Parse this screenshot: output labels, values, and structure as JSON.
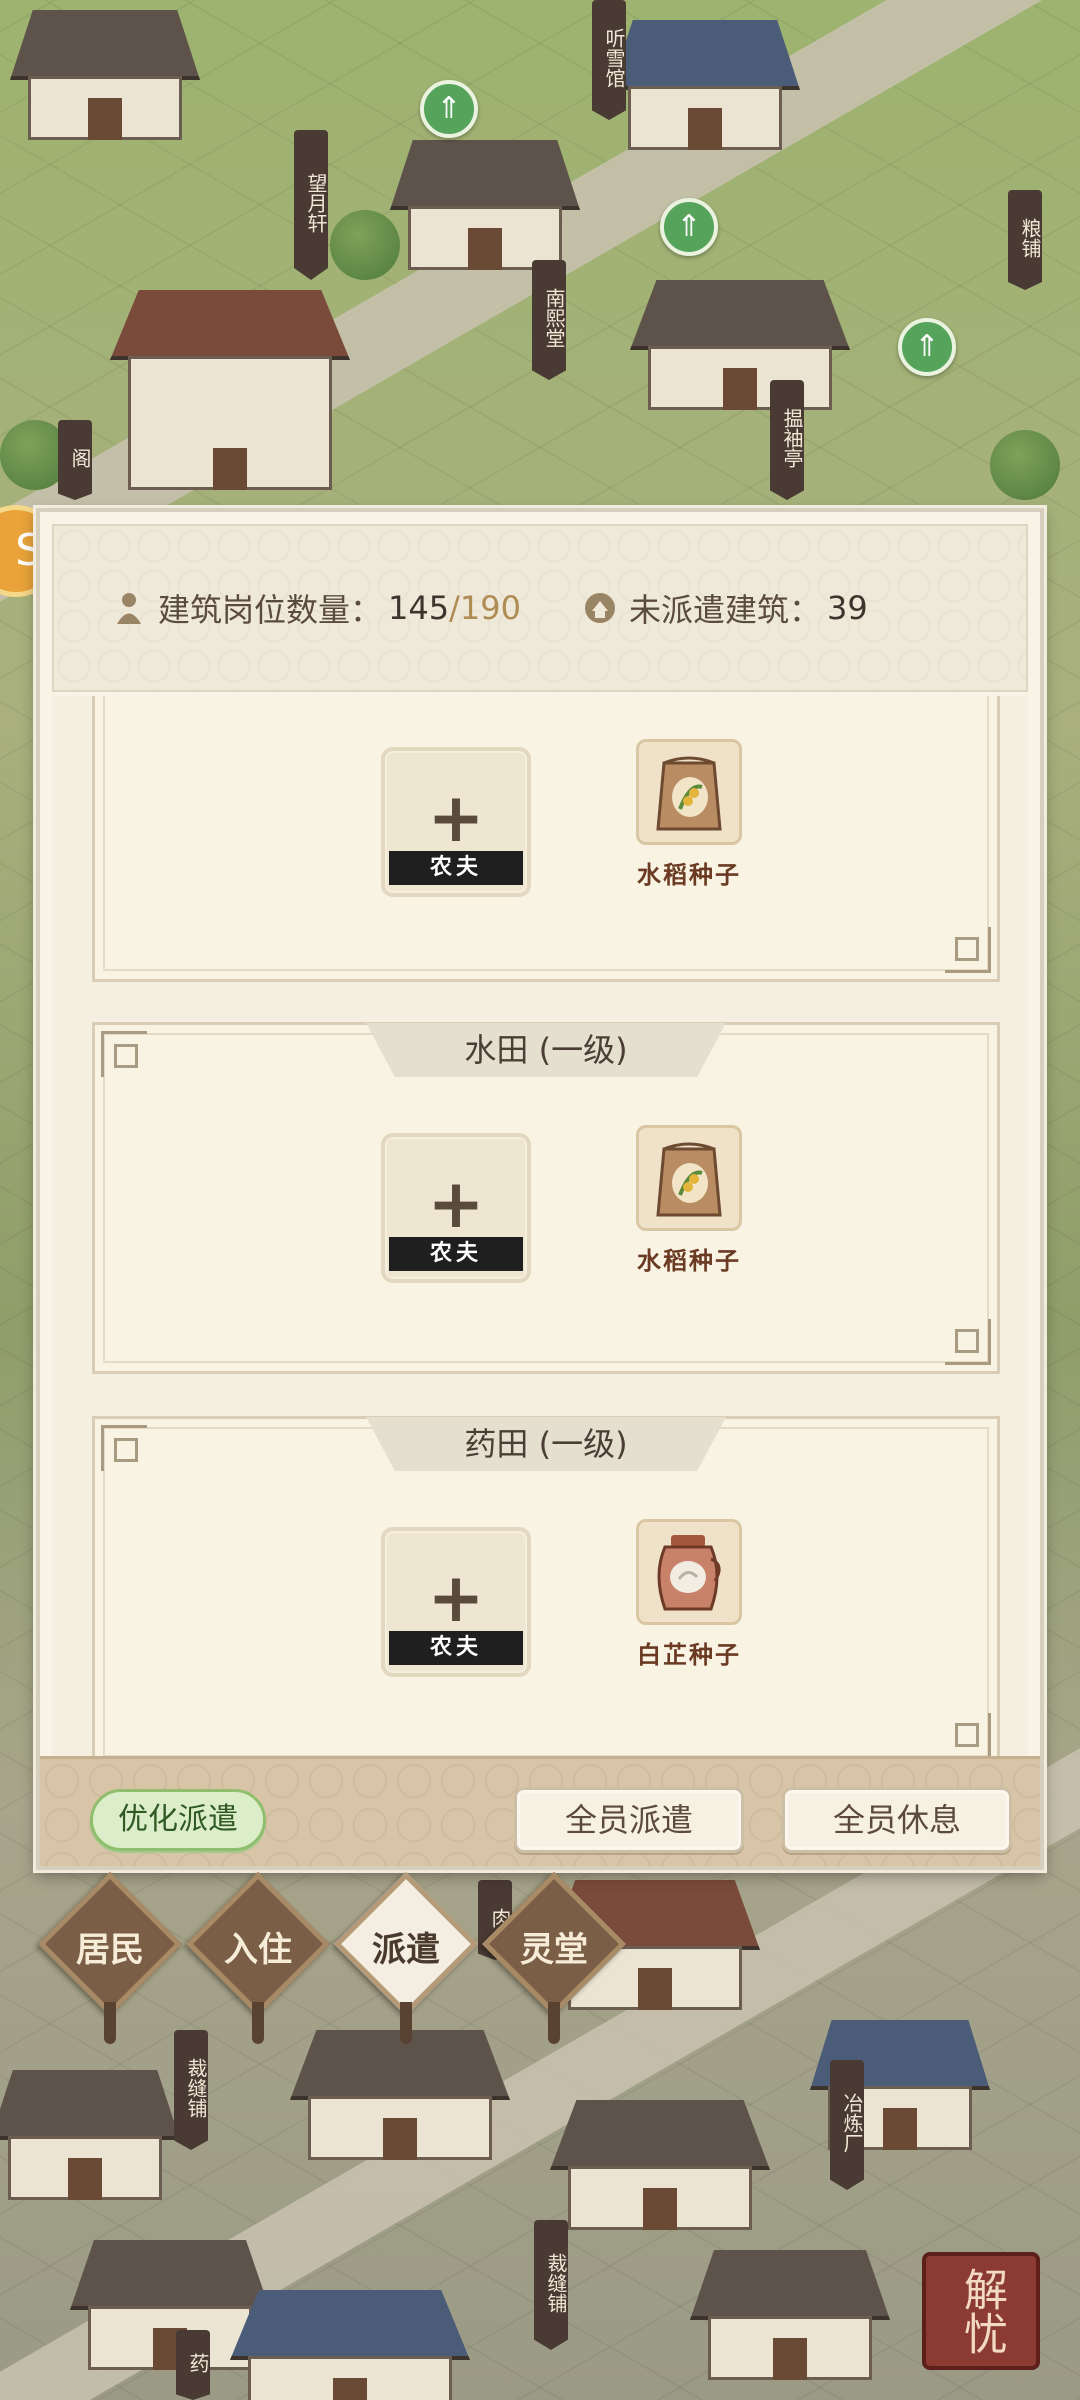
{
  "map": {
    "building_signs": [
      "听雪馆",
      "望月轩",
      "南熙堂",
      "粮铺",
      "揾袖亭",
      "阁",
      "裁缝铺",
      "冶炼厂",
      "裁缝铺",
      "药",
      "肉"
    ],
    "logo_text": "解忧"
  },
  "panel": {
    "stats": {
      "positions_label": "建筑岗位数量：",
      "positions_current": "145",
      "positions_max": "/190",
      "unassigned_label": "未派遣建筑：",
      "unassigned_value": "39"
    },
    "cards": [
      {
        "title": "",
        "role": "农夫",
        "reward_label": "水稻种子",
        "reward_icon": "rice-seed-bag-icon"
      },
      {
        "title": "水田 (一级)",
        "role": "农夫",
        "reward_label": "水稻种子",
        "reward_icon": "rice-seed-bag-icon"
      },
      {
        "title": "药田 (一级)",
        "role": "农夫",
        "reward_label": "白芷种子",
        "reward_icon": "angelica-seed-jar-icon"
      }
    ],
    "footer": {
      "optimize": "优化派遣",
      "all_dispatch": "全员派遣",
      "all_rest": "全员休息"
    }
  },
  "tabs": [
    {
      "label": "居民",
      "active": false
    },
    {
      "label": "入住",
      "active": false
    },
    {
      "label": "派遣",
      "active": true
    },
    {
      "label": "灵堂",
      "active": false
    }
  ],
  "colors": {
    "panel_bg": "#f7f3e7",
    "footer_bg": "#d8c5a8",
    "optimize_green": "#8fbf6c",
    "tab_brown": "#7a5e46"
  }
}
